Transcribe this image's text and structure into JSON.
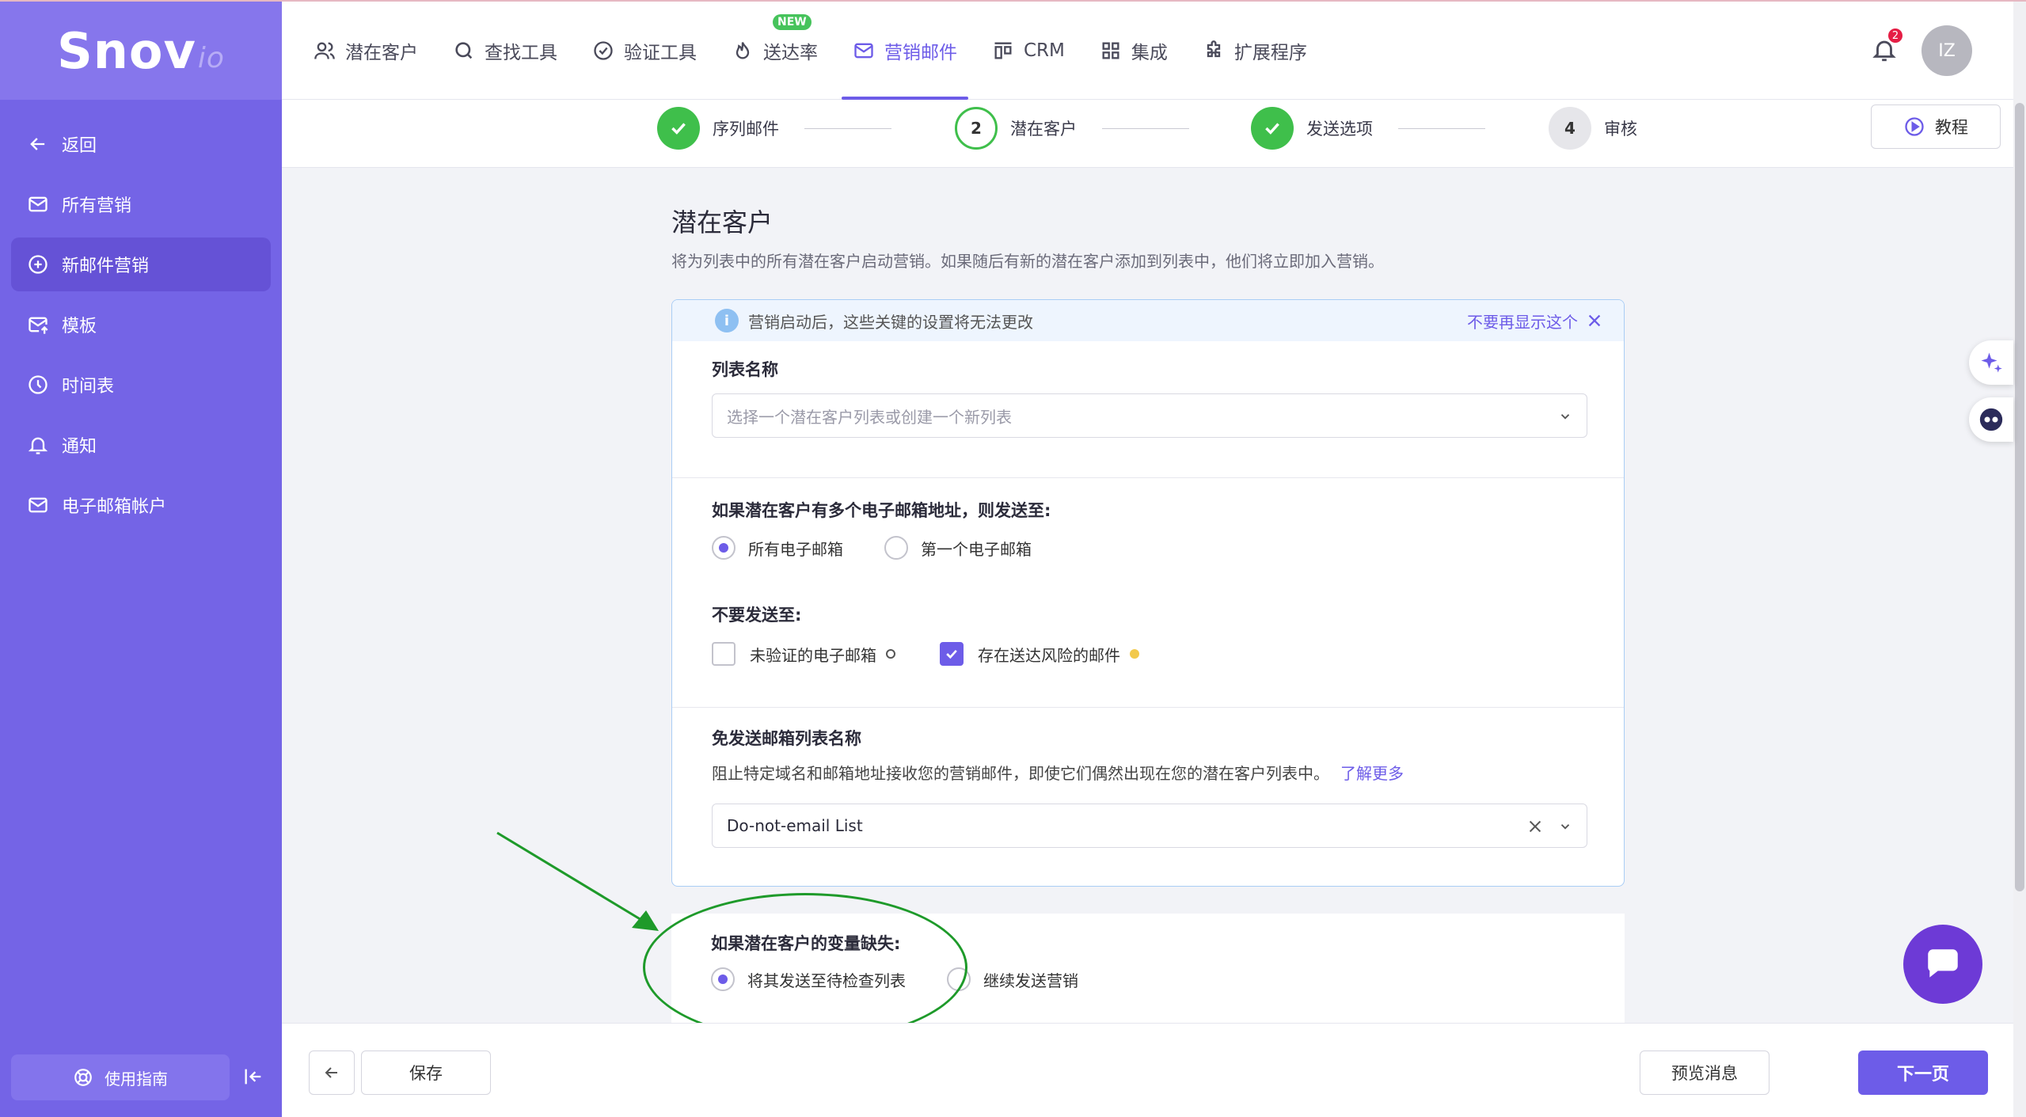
{
  "brand": {
    "logo_main": "Snov",
    "logo_suffix": "io"
  },
  "sidebar": {
    "items": [
      {
        "label": "返回",
        "icon": "arrow-left-icon"
      },
      {
        "label": "所有营销",
        "icon": "mail-icon"
      },
      {
        "label": "新邮件营销",
        "icon": "plus-circle-icon",
        "active": true
      },
      {
        "label": "模板",
        "icon": "mail-upload-icon"
      },
      {
        "label": "时间表",
        "icon": "clock-icon"
      },
      {
        "label": "通知",
        "icon": "bell-icon"
      },
      {
        "label": "电子邮箱帐户",
        "icon": "mail-icon"
      }
    ],
    "guide_label": "使用指南"
  },
  "topnav": {
    "items": [
      {
        "label": "潜在客户",
        "icon": "users-icon"
      },
      {
        "label": "查找工具",
        "icon": "search-icon"
      },
      {
        "label": "验证工具",
        "icon": "check-circle-icon"
      },
      {
        "label": "送达率",
        "icon": "flame-icon",
        "badge": "NEW"
      },
      {
        "label": "营销邮件",
        "icon": "mail-icon",
        "active": true
      },
      {
        "label": "CRM",
        "icon": "crm-icon"
      },
      {
        "label": "集成",
        "icon": "grid-icon"
      },
      {
        "label": "扩展程序",
        "icon": "puzzle-icon"
      }
    ],
    "notification_count": "2",
    "avatar_initials": "IZ"
  },
  "stepper": {
    "steps": [
      {
        "label": "序列邮件",
        "state": "done"
      },
      {
        "label": "潜在客户",
        "state": "current",
        "number": "2"
      },
      {
        "label": "发送选项",
        "state": "done"
      },
      {
        "label": "审核",
        "state": "todo",
        "number": "4"
      }
    ],
    "tutorial_label": "教程"
  },
  "main": {
    "title": "潜在客户",
    "subtitle": "将为列表中的所有潜在客户启动营销。如果随后有新的潜在客户添加到列表中，他们将立即加入营销。",
    "info_text": "营销启动后，这些关键的设置将无法更改",
    "dismiss_label": "不要再显示这个",
    "list_name_label": "列表名称",
    "list_placeholder": "选择一个潜在客户列表或创建一个新列表",
    "multi_email_label": "如果潜在客户有多个电子邮箱地址，则发送至:",
    "multi_email_options": [
      "所有电子邮箱",
      "第一个电子邮箱"
    ],
    "do_not_send_label": "不要发送至:",
    "do_not_send_options": [
      {
        "label": "未验证的电子邮箱",
        "checked": false
      },
      {
        "label": "存在送达风险的邮件",
        "checked": true
      }
    ],
    "dne_label": "免发送邮箱列表名称",
    "dne_desc": "阻止特定域名和邮箱地址接收您的营销邮件，即使它们偶然出现在您的潜在客户列表中。",
    "dne_learn_more": "了解更多",
    "dne_value": "Do-not-email List",
    "missing_var_label": "如果潜在客户的变量缺失:",
    "missing_var_options": [
      "将其发送至待检查列表",
      "继续发送营销"
    ]
  },
  "footer": {
    "save_label": "保存",
    "preview_label": "预览消息",
    "next_label": "下一页"
  },
  "colors": {
    "accent": "#6d5ce8",
    "sidebar": "#7464e6",
    "success": "#3fbf4b",
    "annotation": "#1e9a2a"
  }
}
